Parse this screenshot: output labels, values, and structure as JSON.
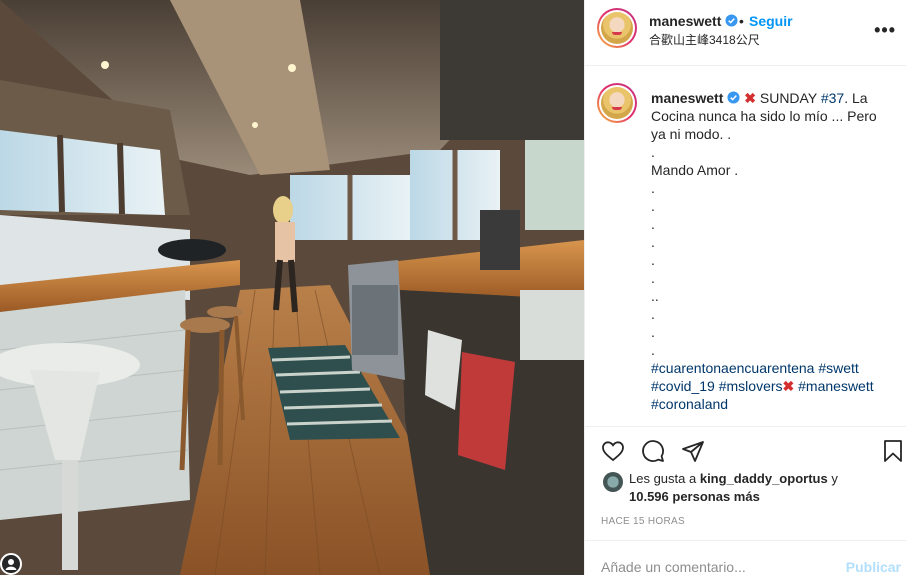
{
  "post": {
    "image_alt": "Kitchen interior photo",
    "header": {
      "username": "maneswett",
      "separator": "•",
      "follow_label": "Seguir",
      "location": "合歡山主峰3418公尺",
      "more_label": "•••"
    },
    "caption": {
      "username": "maneswett",
      "line1": "SUNDAY",
      "tag37": "#37",
      "line1b": ". La Cocina nunca ha sido lo mío ... Pero ya ni modo. .",
      "dot": ".",
      "mando": "Mando Amor .",
      "dots": [
        ".",
        ".",
        ".",
        ".",
        ".",
        ".",
        "..",
        ".",
        ".",
        "."
      ],
      "hashtags1": "#cuarentonaencuarentena",
      "hashtags2": "#swett",
      "hashtags3": "#covid_19",
      "hashtags4": "#mslovers",
      "hashtags5": "#maneswett",
      "hashtags6": "#coronaland",
      "x_mark": "✖"
    },
    "likes": {
      "prefix": "Les gusta a",
      "user": "king_daddy_oportus",
      "and": "y",
      "count": "10.596 personas más"
    },
    "time_ago": "HACE 15 HORAS",
    "comment": {
      "placeholder": "Añade un comentario...",
      "publish_label": "Publicar"
    }
  },
  "colors": {
    "link": "#00376b",
    "follow": "#0095f6",
    "publish_disabled": "#b2dffc",
    "verified": "#3897f0"
  }
}
